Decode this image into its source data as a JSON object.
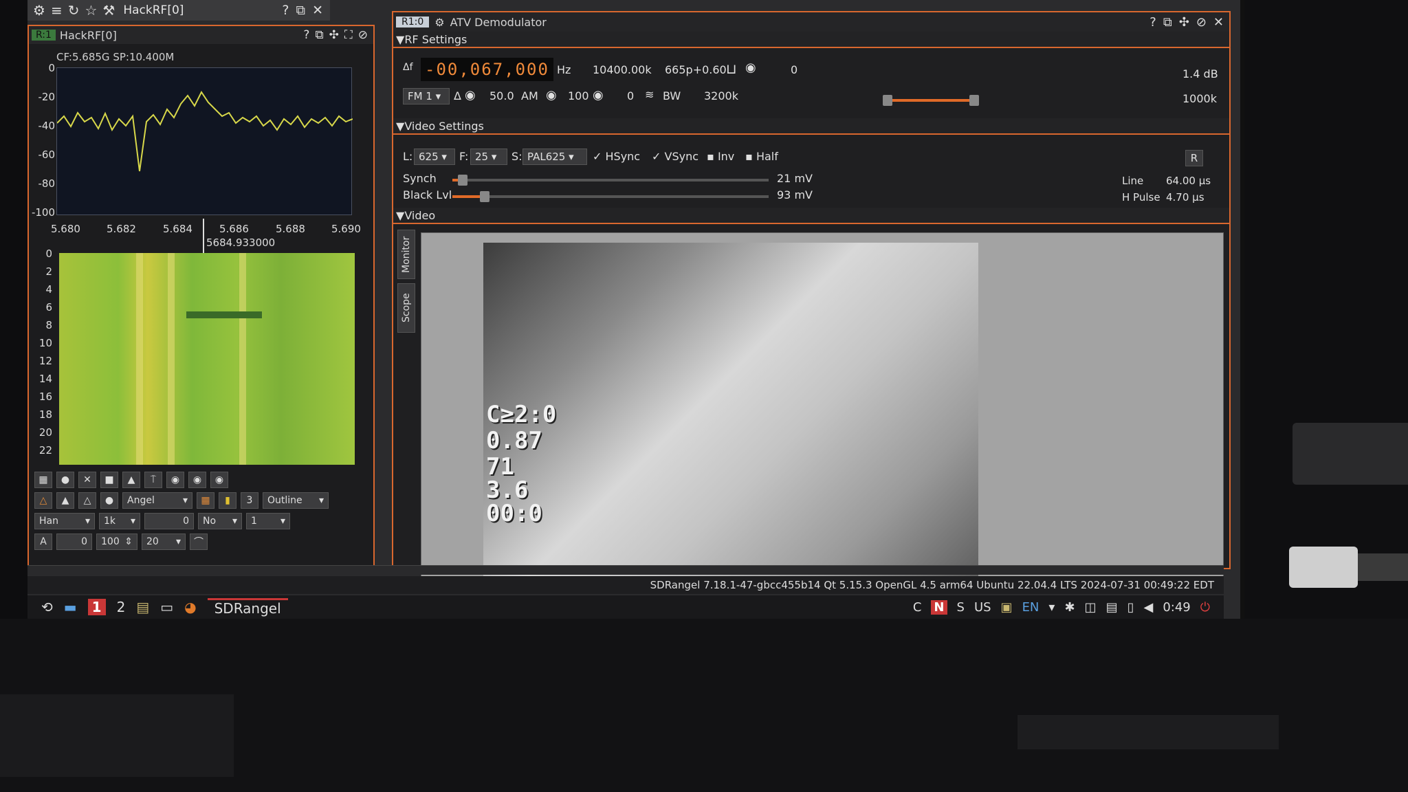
{
  "topbar": {
    "title": "HackRF[0]"
  },
  "left_panel": {
    "badge": "R:1",
    "title": "HackRF[0]",
    "spectrum_info": "CF:5.685G SP:10.400M",
    "y_ticks": [
      "0",
      "-20",
      "-40",
      "-60",
      "-80",
      "-100"
    ],
    "x_ticks": [
      "5.680",
      "5.682",
      "5.684",
      "5.686",
      "5.688",
      "5.690"
    ],
    "marker": "5684.933000",
    "wf_ticks": [
      "0",
      "2",
      "4",
      "6",
      "8",
      "10",
      "12",
      "14",
      "16",
      "18",
      "20",
      "22"
    ],
    "toolbar": {
      "palette": "Angel",
      "fill": "Outline",
      "window": "Han",
      "fft": "1k",
      "overlap": "0",
      "avg_mode": "No",
      "avg": "1",
      "a_label": "A",
      "ref": "0",
      "range": "100",
      "rate": "20"
    }
  },
  "main": {
    "badge": "R1:0",
    "title": "ATV Demodulator",
    "rf_section": "RF Settings",
    "delta": "Δf",
    "freq": "-00,067,000",
    "freq_unit": "Hz",
    "sample_rate": "10400.00k",
    "channel_info": "665p+0.60",
    "zero": "0",
    "gain_db": "1.4 dB",
    "mod": "FM 1",
    "delta_sym": "Δ",
    "fm_dev": "50.0",
    "am_label": "AM",
    "am_val": "100",
    "zero2": "0",
    "bw_label": "BW",
    "bw": "3200k",
    "bw2": "1000k",
    "video_section": "Video Settings",
    "lines_label": "L:",
    "lines": "625",
    "fps_label": "F:",
    "fps": "25",
    "std_label": "S:",
    "std": "PAL625",
    "hsync": "HSync",
    "vsync": "VSync",
    "inv": "Inv",
    "half": "Half",
    "r_btn": "R",
    "synch_label": "Synch",
    "synch_val": "21 mV",
    "black_label": "Black Lvl",
    "black_val": "93 mV",
    "line_label": "Line",
    "line_val": "64.00 µs",
    "hpulse_label": "H Pulse",
    "hpulse_val": "4.70 µs",
    "video_label": "Video",
    "monitor_tab": "Monitor",
    "scope_tab": "Scope",
    "osd": [
      "C≥2:0",
      "0.87",
      "71",
      "3.6",
      "00:0"
    ]
  },
  "status": "SDRangel 7.18.1-47-gbcc455b14 Qt 5.15.3 OpenGL 4.5 arm64 Ubuntu 22.04.4 LTS 2024-07-31 00:49:22 EDT",
  "taskbar": {
    "ws1": "1",
    "ws2": "2",
    "app": "SDRangel",
    "kbd_c": "C",
    "kbd_n": "N",
    "kbd_s": "S",
    "layout": "US",
    "lang": "EN",
    "clock": "0:49"
  }
}
